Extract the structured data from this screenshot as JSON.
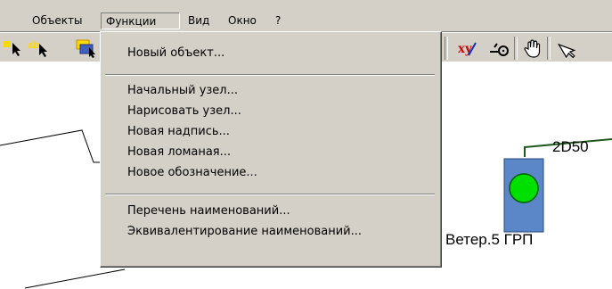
{
  "menubar": {
    "items": [
      "Объекты",
      "Функции",
      "Вид",
      "Окно",
      "?"
    ],
    "open_index": 1
  },
  "toolbar": {
    "buttons": [
      "select-arrow-icon",
      "text-select-icon",
      "object-select-icon",
      "xy-coordinates-icon",
      "node-point-icon",
      "hand-pan-icon",
      "pointer-icon"
    ],
    "xy_label": "xy"
  },
  "dropdown": {
    "group1": [
      "Новый объект..."
    ],
    "group2": [
      "Начальный узел...",
      "Нарисовать узел...",
      "Новая надпись...",
      "Новая ломаная...",
      "Новое обозначение..."
    ],
    "group3": [
      "Перечень наименований...",
      "Эквивалентирование наименований..."
    ]
  },
  "canvas": {
    "label_2d50": "2D50",
    "label_grp": "Ветер.5 ГРП",
    "colors": {
      "grp_box": "#5b86c7",
      "grp_node": "#00e000",
      "pipe": "#1e5a1e"
    }
  }
}
